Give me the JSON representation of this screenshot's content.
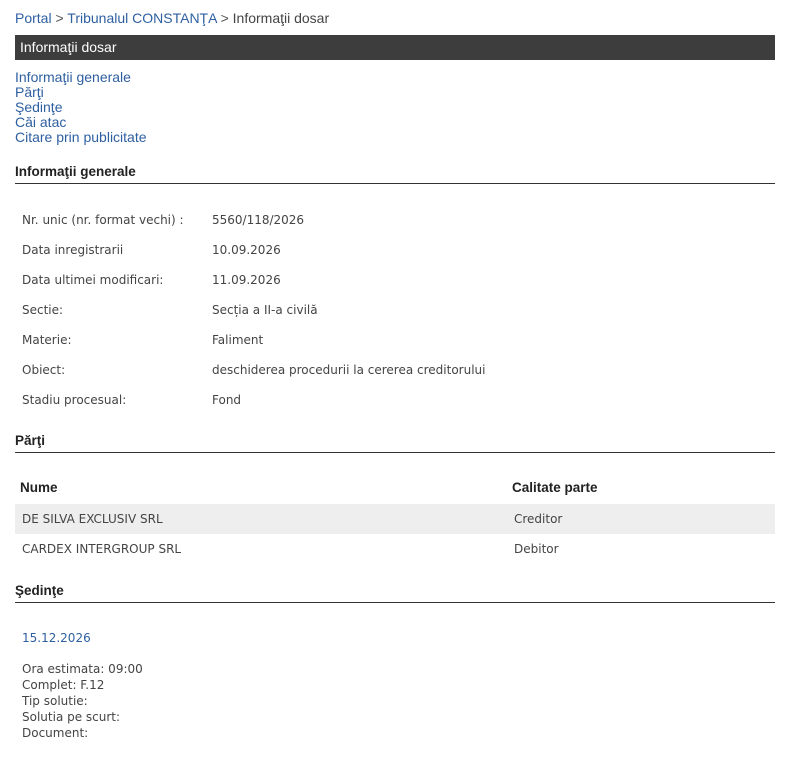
{
  "breadcrumb": {
    "portal": "Portal",
    "sep1": ">",
    "court": "Tribunalul CONSTANŢA",
    "sep2": ">",
    "current": "Informaţii dosar"
  },
  "title_bar": "Informaţii dosar",
  "toc": [
    "Informaţii generale",
    "Părţi",
    "Şedinţe",
    "Căi atac",
    "Citare prin publicitate"
  ],
  "general": {
    "heading": "Informaţii generale",
    "rows": [
      {
        "label": "Nr. unic (nr. format vechi) :",
        "value": "5560/118/2026"
      },
      {
        "label": "Data inregistrarii",
        "value": "10.09.2026"
      },
      {
        "label": "Data ultimei modificari:",
        "value": "11.09.2026"
      },
      {
        "label": "Sectie:",
        "value": "Secția a II-a civilă"
      },
      {
        "label": "Materie:",
        "value": "Faliment"
      },
      {
        "label": "Obiect:",
        "value": "deschiderea procedurii la cererea creditorului"
      },
      {
        "label": "Stadiu procesual:",
        "value": "Fond"
      }
    ]
  },
  "parti": {
    "heading": "Părţi",
    "col_name": "Nume",
    "col_role": "Calitate parte",
    "rows": [
      {
        "name": "DE SILVA EXCLUSIV SRL",
        "role": "Creditor"
      },
      {
        "name": "CARDEX INTERGROUP SRL",
        "role": "Debitor"
      }
    ]
  },
  "sedinte": {
    "heading": "Şedinţe",
    "date": "15.12.2026",
    "details": [
      "Ora estimata: 09:00",
      "Complet: F.12",
      "Tip solutie:",
      "Solutia pe scurt:",
      "Document:"
    ]
  }
}
